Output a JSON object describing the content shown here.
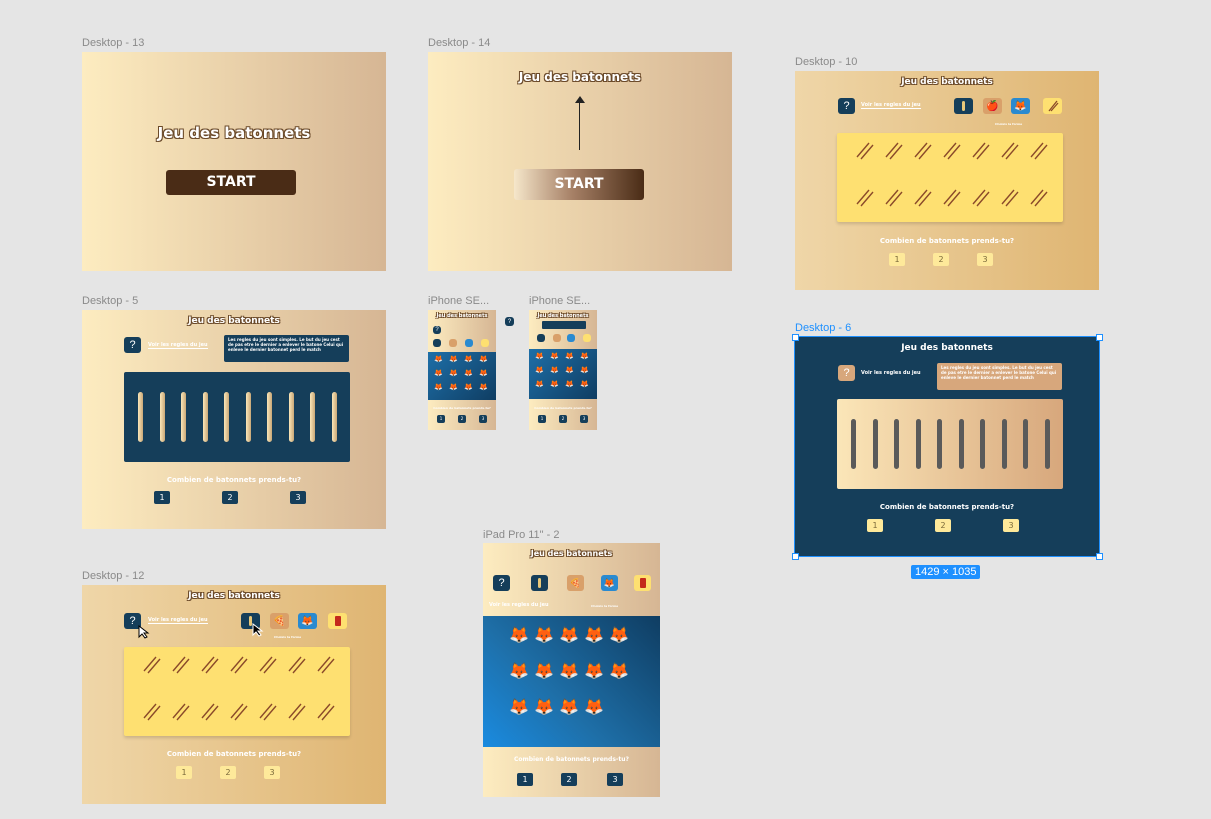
{
  "frames": {
    "d13": {
      "label": "Desktop - 13",
      "title": "Jeu des batonnets",
      "start": "START"
    },
    "d14": {
      "label": "Desktop - 14",
      "title": "Jeu des batonnets",
      "start": "START"
    },
    "d10": {
      "label": "Desktop - 10",
      "title": "Jeu des batonnets",
      "rules_link": "Voir les regles du jeu",
      "choose": "Choisis la forme",
      "question": "Combien de batonnets prends-tu?",
      "choices": [
        "1",
        "2",
        "3"
      ]
    },
    "d5": {
      "label": "Desktop - 5",
      "title": "Jeu des batonnets",
      "rules_link": "Voir les regles du jeu",
      "rules_text": "Les regles du jeu sont simples. Le but du jeu cest de pas etre le dernier a enlever le batone Celui qui enleve le dernier batonnet perd le match",
      "question": "Combien de batonnets prends-tu?",
      "choices": [
        "1",
        "2",
        "3"
      ]
    },
    "iphone1": {
      "label": "iPhone SE...",
      "title": "Jeu des batonnets",
      "question": "Combien de batonnets prends-tu?",
      "choices": [
        "1",
        "2",
        "3"
      ]
    },
    "iphone2": {
      "label": "iPhone SE...",
      "title": "Jeu des batonnets",
      "question": "Combien de batonnets prends-tu?",
      "choices": [
        "1",
        "2",
        "3"
      ]
    },
    "d6": {
      "label": "Desktop - 6",
      "title": "Jeu des batonnets",
      "rules_link": "Voir les regles du jeu",
      "rules_text": "Les regles du jeu sont simples. Le but du jeu cest de pas etre le dernier a enlever le batone Celui qui enleve le dernier batonnet perd le match",
      "question": "Combien de batonnets prends-tu?",
      "choices": [
        "1",
        "2",
        "3"
      ],
      "size": "1429 × 1035"
    },
    "d12": {
      "label": "Desktop - 12",
      "title": "Jeu des batonnets",
      "rules_link": "Voir les regles du jeu",
      "choose": "Choisis la forme",
      "question": "Combien de batonnets prends-tu?",
      "choices": [
        "1",
        "2",
        "3"
      ]
    },
    "ipad": {
      "label": "iPad Pro 11\" - 2",
      "title": "Jeu des batonnets",
      "rules_link": "Voir les regles du jeu",
      "choose": "Choisis la forme",
      "question": "Combien de batonnets prends-tu?",
      "choices": [
        "1",
        "2",
        "3"
      ]
    }
  },
  "icons": {
    "help": "?",
    "fox": "🦊",
    "apple": "🍎",
    "pizza": "🍕",
    "stick": "❘",
    "chopsticks": "𐄂"
  }
}
